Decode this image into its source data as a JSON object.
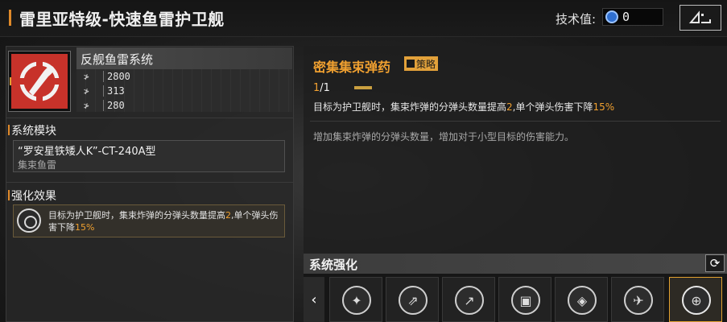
{
  "header": {
    "title": "雷里亚特级-快速鱼雷护卫舰",
    "tech_label": "技术值:",
    "tech_value": "0"
  },
  "weapon": {
    "system_name": "反舰鱼雷系统",
    "stats": [
      {
        "icon": "damage-icon",
        "value": "2800"
      },
      {
        "icon": "speed-icon",
        "value": "313"
      },
      {
        "icon": "range-icon",
        "value": "280"
      }
    ]
  },
  "module_section": {
    "heading": "系统模块",
    "module_name": "“罗安星铁矮人K”-CT-240A型",
    "module_type": "集束鱼雷"
  },
  "effect_section": {
    "heading": "强化效果",
    "text_a": "目标为护卫舰时，集束炸弹的分弹头数量提高",
    "value_a": "2",
    "text_b": ",单个弹头伤害下降",
    "value_b": "15%"
  },
  "ammo": {
    "title": "密集集束弹药",
    "tag": "策略",
    "count_current": "1",
    "count_total": "/1",
    "desc_a": "目标为护卫舰时，集束炸弹的分弹头数量提高",
    "desc_value_a": "2",
    "desc_b": ",单个弹头伤害下降",
    "desc_value_b": "15%",
    "note": "增加集束炸弹的分弹头数量，增加对于小型目标的伤害能力。"
  },
  "enhancement": {
    "title": "系统强化",
    "slots": [
      {
        "icon": "compass-missile-icon"
      },
      {
        "icon": "double-missile-icon"
      },
      {
        "icon": "missile-angle-icon"
      },
      {
        "icon": "chip-icon"
      },
      {
        "icon": "cube-icon"
      },
      {
        "icon": "drone-icon"
      },
      {
        "icon": "crosshair-icon",
        "selected": true
      }
    ]
  },
  "colors": {
    "accent": "#f0a030",
    "weapon_icon_bg": "#c7322a"
  }
}
